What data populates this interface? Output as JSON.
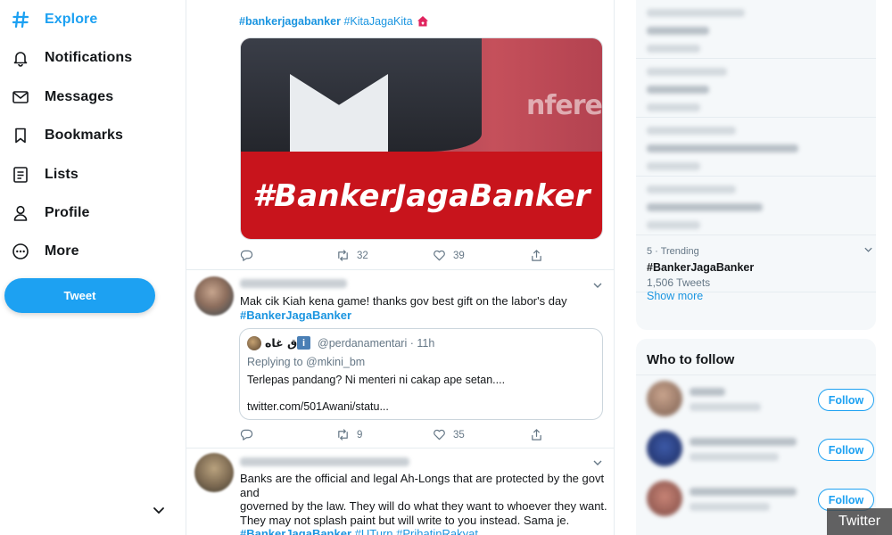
{
  "nav": {
    "items": [
      {
        "label": "Explore",
        "icon": "hash-icon"
      },
      {
        "label": "Notifications",
        "icon": "bell-icon"
      },
      {
        "label": "Messages",
        "icon": "envelope-icon"
      },
      {
        "label": "Bookmarks",
        "icon": "bookmark-icon"
      },
      {
        "label": "Lists",
        "icon": "list-icon"
      },
      {
        "label": "Profile",
        "icon": "person-icon"
      },
      {
        "label": "More",
        "icon": "more-circle-icon"
      }
    ],
    "active": "Explore",
    "tweet_button": "Tweet"
  },
  "feed": {
    "tweet1": {
      "hashtags": [
        "#bankerjagabanker",
        "#KitaJagaKita"
      ],
      "media_text": "#BankerJagaBanker",
      "media_bg_text": "nference",
      "stats": {
        "replies": "",
        "retweets": "32",
        "likes": "39"
      }
    },
    "tweet2": {
      "text": "Mak cik Kiah kena game! thanks gov best gift on the labor's day",
      "hashtag": "#BankerJagaBanker",
      "quote": {
        "name": "فاق غاه",
        "badge": "i",
        "handle": "@perdanamentari · 11h",
        "replying": "Replying to @mkini_bm",
        "text": "Terlepas pandang? Ni menteri ni cakap ape setan....",
        "link": "twitter.com/501Awani/statu..."
      },
      "stats": {
        "replies": "",
        "retweets": "9",
        "likes": "35"
      }
    },
    "tweet3": {
      "lines": [
        "Banks are the official and legal Ah-Longs that are protected by the govt and",
        "governed by the law. They will do what they want to whoever they want.",
        "They may not splash paint but will write to you instead. Sama je."
      ],
      "hashtags": [
        "#BankerJagaBanker",
        "#UTurn",
        "#PrihatinRakyat"
      ]
    }
  },
  "trends": {
    "highlight": {
      "meta": "5 · Trending",
      "name": "#BankerJagaBanker",
      "count": "1,506 Tweets"
    },
    "show_more": "Show more"
  },
  "who_to_follow": {
    "title": "Who to follow",
    "follow_label": "Follow"
  },
  "watermark": "Twitter",
  "colors": {
    "accent": "#1da1f2",
    "link": "#1b95e0",
    "media_band": "#c8141c"
  }
}
